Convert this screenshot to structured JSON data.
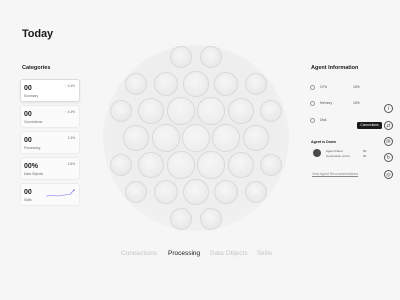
{
  "page": {
    "title": "Today"
  },
  "categories": {
    "heading": "Categories",
    "items": [
      {
        "value": "00",
        "label": "Summary",
        "delta": "↑ 3.4%",
        "active": true
      },
      {
        "value": "00",
        "label": "Connections",
        "delta": "↑ 4.4%",
        "active": false
      },
      {
        "value": "00",
        "label": "Processing",
        "delta": "1.3%",
        "active": false
      },
      {
        "value": "00%",
        "label": "Data Objects",
        "delta": "1.8%",
        "active": false
      },
      {
        "value": "00",
        "label": "Skills",
        "delta": "",
        "active": false,
        "sparkline": true
      }
    ]
  },
  "tabs": [
    "Connections",
    "Processing",
    "Data Objects",
    "Skills"
  ],
  "active_tab": "Processing",
  "agent": {
    "title": "Agent Information",
    "metrics": [
      {
        "label": "CPU",
        "value": "15%",
        "icon": "cpu-icon"
      },
      {
        "label": "Memory",
        "value": "15%",
        "icon": "memory-icon"
      },
      {
        "label": "Disk",
        "value": "",
        "icon": "disk-icon"
      }
    ],
    "tooltip": "Connections",
    "down": {
      "title": "Agent is Down",
      "line1": "Agent linked",
      "line1_value": "00",
      "line2": "Connection errors",
      "line2_value": "00"
    },
    "view_link": "View Agent Recommendations"
  },
  "rail": [
    {
      "name": "info-icon",
      "glyph": "i"
    },
    {
      "name": "connections-icon",
      "glyph": "⇄"
    },
    {
      "name": "chat-icon",
      "glyph": "✉"
    },
    {
      "name": "refresh-icon",
      "glyph": "↻"
    },
    {
      "name": "sphere-icon",
      "glyph": "◎"
    }
  ],
  "colors": {
    "background": "#f6f6f6",
    "text": "#1a1a1a",
    "muted": "#c4c4c4",
    "tooltip": "#1a1a1a"
  }
}
